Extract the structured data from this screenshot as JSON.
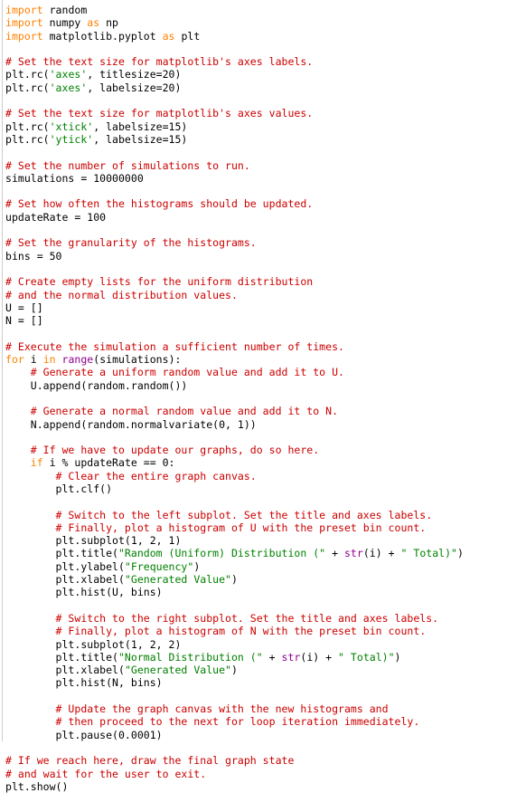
{
  "editor": {
    "language": "python",
    "background": "#ffffff",
    "default_text_color": "#000000",
    "gutter_rule_color": "#cccccc"
  },
  "syntax_colors": {
    "keyword": "#ff8000",
    "comment": "#cc0000",
    "string": "#008000",
    "builtin": "#900090",
    "plain": "#000000"
  },
  "code": {
    "lines": [
      [
        {
          "t": "import",
          "c": "kw"
        },
        {
          "t": " random",
          "c": "pl"
        }
      ],
      [
        {
          "t": "import",
          "c": "kw"
        },
        {
          "t": " numpy ",
          "c": "pl"
        },
        {
          "t": "as",
          "c": "kw"
        },
        {
          "t": " np",
          "c": "pl"
        }
      ],
      [
        {
          "t": "import",
          "c": "kw"
        },
        {
          "t": " matplotlib.pyplot ",
          "c": "pl"
        },
        {
          "t": "as",
          "c": "kw"
        },
        {
          "t": " plt",
          "c": "pl"
        }
      ],
      [],
      [
        {
          "t": "# Set the text size for matplotlib's axes labels.",
          "c": "com"
        }
      ],
      [
        {
          "t": "plt.rc(",
          "c": "pl"
        },
        {
          "t": "'axes'",
          "c": "str"
        },
        {
          "t": ", titlesize=20)",
          "c": "pl"
        }
      ],
      [
        {
          "t": "plt.rc(",
          "c": "pl"
        },
        {
          "t": "'axes'",
          "c": "str"
        },
        {
          "t": ", labelsize=20)",
          "c": "pl"
        }
      ],
      [],
      [
        {
          "t": "# Set the text size for matplotlib's axes values.",
          "c": "com"
        }
      ],
      [
        {
          "t": "plt.rc(",
          "c": "pl"
        },
        {
          "t": "'xtick'",
          "c": "str"
        },
        {
          "t": ", labelsize=15)",
          "c": "pl"
        }
      ],
      [
        {
          "t": "plt.rc(",
          "c": "pl"
        },
        {
          "t": "'ytick'",
          "c": "str"
        },
        {
          "t": ", labelsize=15)",
          "c": "pl"
        }
      ],
      [],
      [
        {
          "t": "# Set the number of simulations to run.",
          "c": "com"
        }
      ],
      [
        {
          "t": "simulations = 10000000",
          "c": "pl"
        }
      ],
      [],
      [
        {
          "t": "# Set how often the histograms should be updated.",
          "c": "com"
        }
      ],
      [
        {
          "t": "updateRate = 100",
          "c": "pl"
        }
      ],
      [],
      [
        {
          "t": "# Set the granularity of the histograms.",
          "c": "com"
        }
      ],
      [
        {
          "t": "bins = 50",
          "c": "pl"
        }
      ],
      [],
      [
        {
          "t": "# Create empty lists for the uniform distribution",
          "c": "com"
        }
      ],
      [
        {
          "t": "# and the normal distribution values.",
          "c": "com"
        }
      ],
      [
        {
          "t": "U = []",
          "c": "pl"
        }
      ],
      [
        {
          "t": "N = []",
          "c": "pl"
        }
      ],
      [],
      [
        {
          "t": "# Execute the simulation a sufficient number of times.",
          "c": "com"
        }
      ],
      [
        {
          "t": "for",
          "c": "kw"
        },
        {
          "t": " i ",
          "c": "pl"
        },
        {
          "t": "in",
          "c": "kw"
        },
        {
          "t": " ",
          "c": "pl"
        },
        {
          "t": "range",
          "c": "bi"
        },
        {
          "t": "(simulations):",
          "c": "pl"
        }
      ],
      [
        {
          "t": "    # Generate a uniform random value and add it to U.",
          "c": "com"
        }
      ],
      [
        {
          "t": "    U.append(random.random())",
          "c": "pl"
        }
      ],
      [],
      [
        {
          "t": "    # Generate a normal random value and add it to N.",
          "c": "com"
        }
      ],
      [
        {
          "t": "    N.append(random.normalvariate(0, 1))",
          "c": "pl"
        }
      ],
      [],
      [
        {
          "t": "    # If we have to update our graphs, do so here.",
          "c": "com"
        }
      ],
      [
        {
          "t": "    ",
          "c": "pl"
        },
        {
          "t": "if",
          "c": "kw"
        },
        {
          "t": " i % updateRate == 0:",
          "c": "pl"
        }
      ],
      [
        {
          "t": "        # Clear the entire graph canvas.",
          "c": "com"
        }
      ],
      [
        {
          "t": "        plt.clf()",
          "c": "pl"
        }
      ],
      [],
      [
        {
          "t": "        # Switch to the left subplot. Set the title and axes labels.",
          "c": "com"
        }
      ],
      [
        {
          "t": "        # Finally, plot a histogram of U with the preset bin count.",
          "c": "com"
        }
      ],
      [
        {
          "t": "        plt.subplot(1, 2, 1)",
          "c": "pl"
        }
      ],
      [
        {
          "t": "        plt.title(",
          "c": "pl"
        },
        {
          "t": "\"Random (Uniform) Distribution (\"",
          "c": "str"
        },
        {
          "t": " + ",
          "c": "pl"
        },
        {
          "t": "str",
          "c": "bi"
        },
        {
          "t": "(i) + ",
          "c": "pl"
        },
        {
          "t": "\" Total)\"",
          "c": "str"
        },
        {
          "t": ")",
          "c": "pl"
        }
      ],
      [
        {
          "t": "        plt.ylabel(",
          "c": "pl"
        },
        {
          "t": "\"Frequency\"",
          "c": "str"
        },
        {
          "t": ")",
          "c": "pl"
        }
      ],
      [
        {
          "t": "        plt.xlabel(",
          "c": "pl"
        },
        {
          "t": "\"Generated Value\"",
          "c": "str"
        },
        {
          "t": ")",
          "c": "pl"
        }
      ],
      [
        {
          "t": "        plt.hist(U, bins)",
          "c": "pl"
        }
      ],
      [],
      [
        {
          "t": "        # Switch to the right subplot. Set the title and axes labels.",
          "c": "com"
        }
      ],
      [
        {
          "t": "        # Finally, plot a histogram of N with the preset bin count.",
          "c": "com"
        }
      ],
      [
        {
          "t": "        plt.subplot(1, 2, 2)",
          "c": "pl"
        }
      ],
      [
        {
          "t": "        plt.title(",
          "c": "pl"
        },
        {
          "t": "\"Normal Distribution (\"",
          "c": "str"
        },
        {
          "t": " + ",
          "c": "pl"
        },
        {
          "t": "str",
          "c": "bi"
        },
        {
          "t": "(i) + ",
          "c": "pl"
        },
        {
          "t": "\" Total)\"",
          "c": "str"
        },
        {
          "t": ")",
          "c": "pl"
        }
      ],
      [
        {
          "t": "        plt.xlabel(",
          "c": "pl"
        },
        {
          "t": "\"Generated Value\"",
          "c": "str"
        },
        {
          "t": ")",
          "c": "pl"
        }
      ],
      [
        {
          "t": "        plt.hist(N, bins)",
          "c": "pl"
        }
      ],
      [],
      [
        {
          "t": "        # Update the graph canvas with the new histograms and",
          "c": "com"
        }
      ],
      [
        {
          "t": "        # then proceed to the next for loop iteration immediately.",
          "c": "com"
        }
      ],
      [
        {
          "t": "        plt.pause(0.0001)",
          "c": "pl"
        }
      ],
      [],
      [
        {
          "t": "# If we reach here, draw the final graph state",
          "c": "com"
        }
      ],
      [
        {
          "t": "# and wait for the user to exit.",
          "c": "com"
        }
      ],
      [
        {
          "t": "plt.show()",
          "c": "pl"
        }
      ]
    ]
  }
}
